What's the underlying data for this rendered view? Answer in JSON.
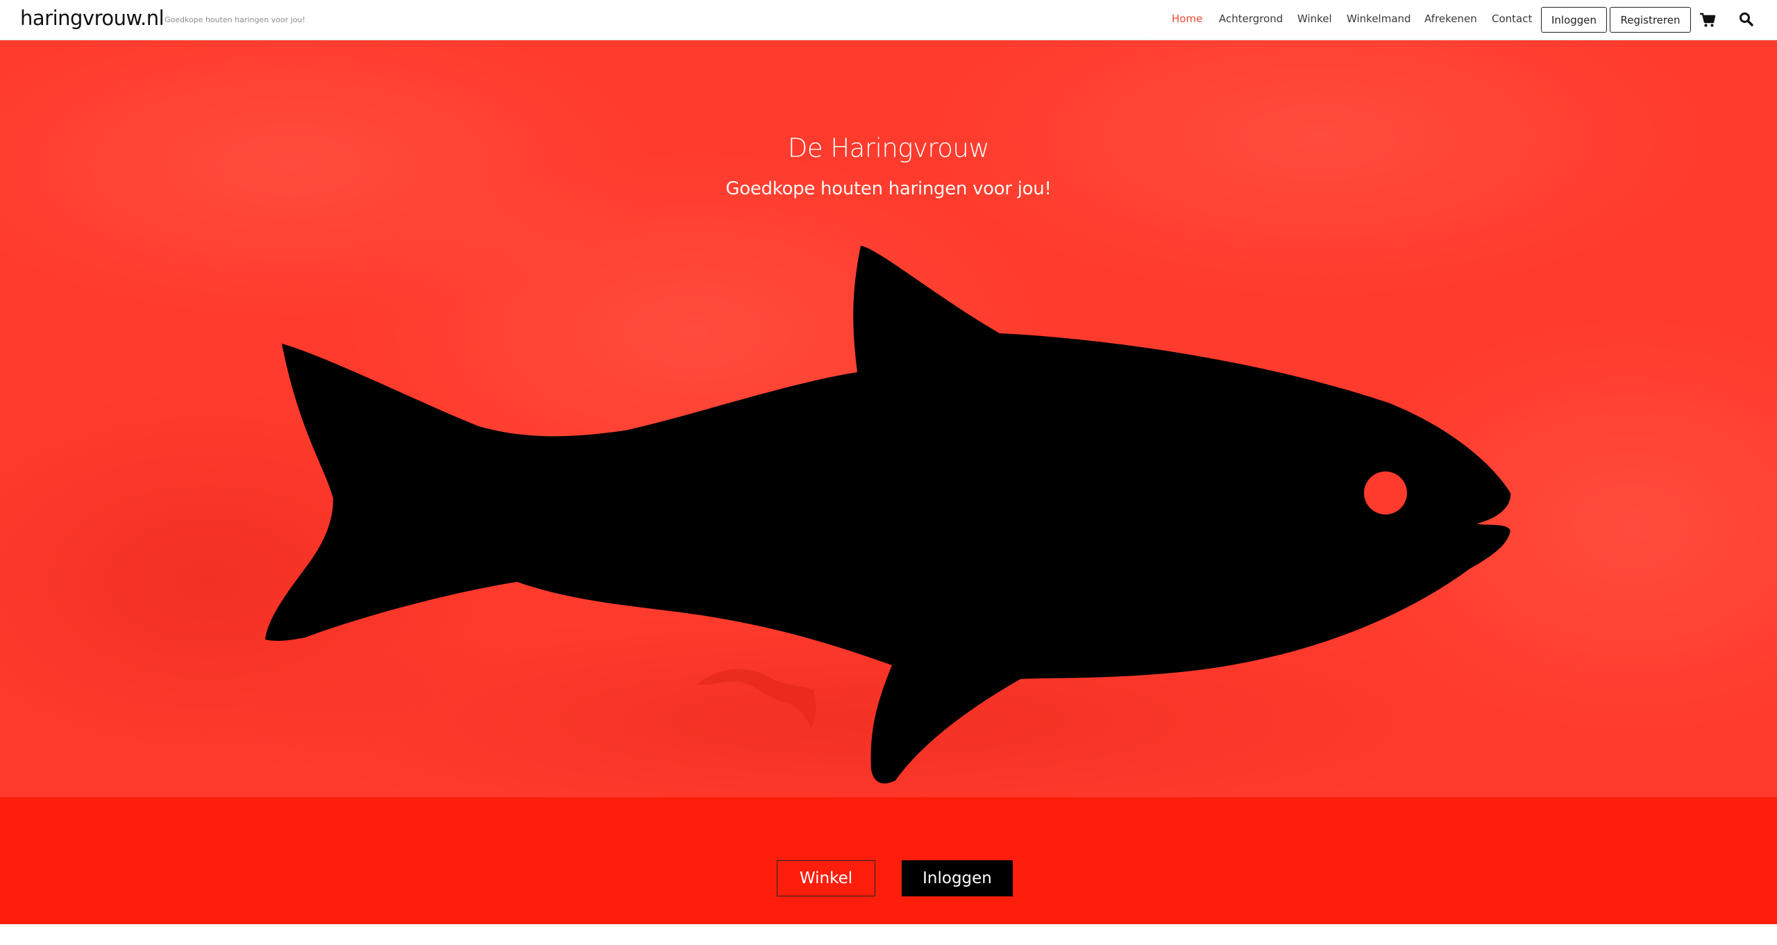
{
  "header": {
    "brand": "haringvrouw.nl",
    "tagline": "Goedkope houten haringen voor jou!",
    "nav": [
      {
        "label": "Home",
        "active": true
      },
      {
        "label": "Achtergrond"
      },
      {
        "label": "Winkel"
      },
      {
        "label": "Winkelmand"
      },
      {
        "label": "Afrekenen"
      },
      {
        "label": "Contact"
      }
    ],
    "login_label": "Inloggen",
    "register_label": "Registreren",
    "cart_icon": "cart-icon",
    "search_icon": "search-icon"
  },
  "hero": {
    "title": "De Haringvrouw",
    "subtitle": "Goedkope houten haringen voor jou!",
    "image": "fish-silhouette"
  },
  "actions": {
    "shop_label": "Winkel",
    "login_label": "Inloggen"
  },
  "colors": {
    "accent": "#f04a38",
    "hero_bg": "#ff3a2c",
    "band_bg": "#ff1e0c",
    "fish": "#000000"
  }
}
